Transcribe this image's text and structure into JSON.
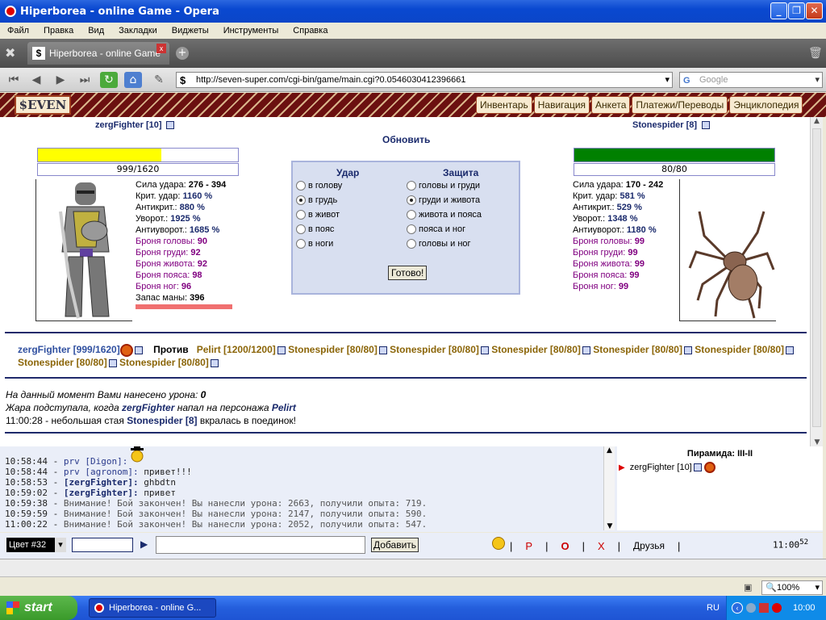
{
  "window": {
    "title": "Hiperborea - online Game - Opera"
  },
  "menu": [
    "Файл",
    "Правка",
    "Вид",
    "Закладки",
    "Виджеты",
    "Инструменты",
    "Справка"
  ],
  "tab": {
    "title": "Hiperborea - online Game"
  },
  "url": "http://seven-super.com/cgi-bin/game/main.cgi?0.0546030412396661",
  "search_placeholder": "Google",
  "game": {
    "logo": "$EVEN",
    "nav": [
      "Инвентарь",
      "Навигация",
      "Анкета",
      "Платежи/Переводы",
      "Энциклопедия"
    ],
    "refresh": "Обновить",
    "player": {
      "name": "zergFighter [10]",
      "hp_text": "999/1620",
      "hp_fraction": 0.617,
      "hp_color": "#ffff00",
      "stats": [
        {
          "label": "Сила удара: ",
          "value": "276 - 394",
          "purple": false
        },
        {
          "label": "Крит. удар: ",
          "value": "1160 %",
          "purple": false
        },
        {
          "label": "Антикрит.: ",
          "value": "880 %",
          "purple": false
        },
        {
          "label": "Уворот.: ",
          "value": "1925 %",
          "purple": false
        },
        {
          "label": "Антиуворот.: ",
          "value": "1685 %",
          "purple": false
        },
        {
          "label": "Броня головы: ",
          "value": "90",
          "purple": true
        },
        {
          "label": "Броня груди: ",
          "value": "92",
          "purple": true
        },
        {
          "label": "Броня живота: ",
          "value": "92",
          "purple": true
        },
        {
          "label": "Броня пояса: ",
          "value": "98",
          "purple": true
        },
        {
          "label": "Броня ног: ",
          "value": "96",
          "purple": true
        },
        {
          "label": "Запас маны: ",
          "value": "396",
          "purple": false
        }
      ]
    },
    "enemy": {
      "name": "Stonespider [8]",
      "hp_text": "80/80",
      "hp_fraction": 1.0,
      "hp_color": "#008000",
      "stats": [
        {
          "label": "Сила удара: ",
          "value": "170 - 242",
          "purple": false
        },
        {
          "label": "Крит. удар: ",
          "value": "581 %",
          "purple": false
        },
        {
          "label": "Антикрит.: ",
          "value": "529 %",
          "purple": false
        },
        {
          "label": "Уворот.: ",
          "value": "1348 %",
          "purple": false
        },
        {
          "label": "Антиуворот.: ",
          "value": "1180 %",
          "purple": false
        },
        {
          "label": "Броня головы: ",
          "value": "99",
          "purple": true
        },
        {
          "label": "Броня груди: ",
          "value": "99",
          "purple": true
        },
        {
          "label": "Броня живота: ",
          "value": "99",
          "purple": true
        },
        {
          "label": "Броня пояса: ",
          "value": "99",
          "purple": true
        },
        {
          "label": "Броня ног: ",
          "value": "99",
          "purple": true
        }
      ]
    },
    "attack": {
      "hit_header": "Удар",
      "defend_header": "Защита",
      "hit_options": [
        "в голову",
        "в грудь",
        "в живот",
        "в пояс",
        "в ноги"
      ],
      "hit_selected": 1,
      "defend_options": [
        "головы и груди",
        "груди и живота",
        "живота и пояса",
        "пояса и ног",
        "головы и ног"
      ],
      "defend_selected": 1,
      "ready": "Готово!"
    },
    "versus": {
      "left": "zergFighter [999/1620]",
      "against": "Против",
      "right": [
        "Pelirt [1200/1200]",
        "Stonespider [80/80]",
        "Stonespider [80/80]",
        "Stonespider [80/80]",
        "Stonespider [80/80]",
        "Stonespider [80/80]",
        "Stonespider [80/80]",
        "Stonespider [80/80]"
      ]
    },
    "log": {
      "damage_prefix": "На данный момент Вами нанесено урона: ",
      "damage_value": "0",
      "line2_a": "Жара подступала, когда ",
      "line2_b": "zergFighter",
      "line2_c": " напал на персонажа ",
      "line2_d": "Pelirt",
      "line3_time": "11:00:28 - небольшая стая ",
      "line3_name": "Stonespider [8]",
      "line3_end": " вкралась в поединок!"
    }
  },
  "chat": {
    "messages": [
      {
        "time": "10:58:44 - ",
        "who": "prv [Digon]:",
        "text": "",
        "kind": "prv"
      },
      {
        "time": "10:58:44 - ",
        "who": "prv [agronom]:",
        "text": " привет!!!",
        "kind": "prv"
      },
      {
        "time": "10:58:53 - ",
        "who": "[zergFighter]:",
        "text": " ghbdtn",
        "kind": "me"
      },
      {
        "time": "10:59:02 - ",
        "who": "[zergFighter]:",
        "text": " привет",
        "kind": "me"
      },
      {
        "time": "10:59:38 - ",
        "who": "",
        "text": "Внимание! Бой закончен! Вы нанесли урона: 2663, получили опыта: 719.",
        "kind": "sys"
      },
      {
        "time": "10:59:59 - ",
        "who": "",
        "text": "Внимание! Бой закончен! Вы нанесли урона: 2147, получили опыта: 590.",
        "kind": "sys"
      },
      {
        "time": "11:00:22 - ",
        "who": "",
        "text": "Внимание! Бой закончен! Вы нанесли урона: 2052, получили опыта: 547.",
        "kind": "sys"
      }
    ],
    "roster_title": "Пирамида: III-II",
    "roster_user": "zergFighter [10]",
    "color_select": "Цвет #32",
    "add_button": "Добавить",
    "links": [
      "Р",
      "О",
      "Х"
    ],
    "friends": "Друзья",
    "clock": "11:00",
    "clock_sec": "52"
  },
  "status": {
    "zoom": "100%"
  },
  "taskbar": {
    "start": "start",
    "item": "Hiperborea - online G...",
    "lang": "RU",
    "time": "10:00"
  }
}
